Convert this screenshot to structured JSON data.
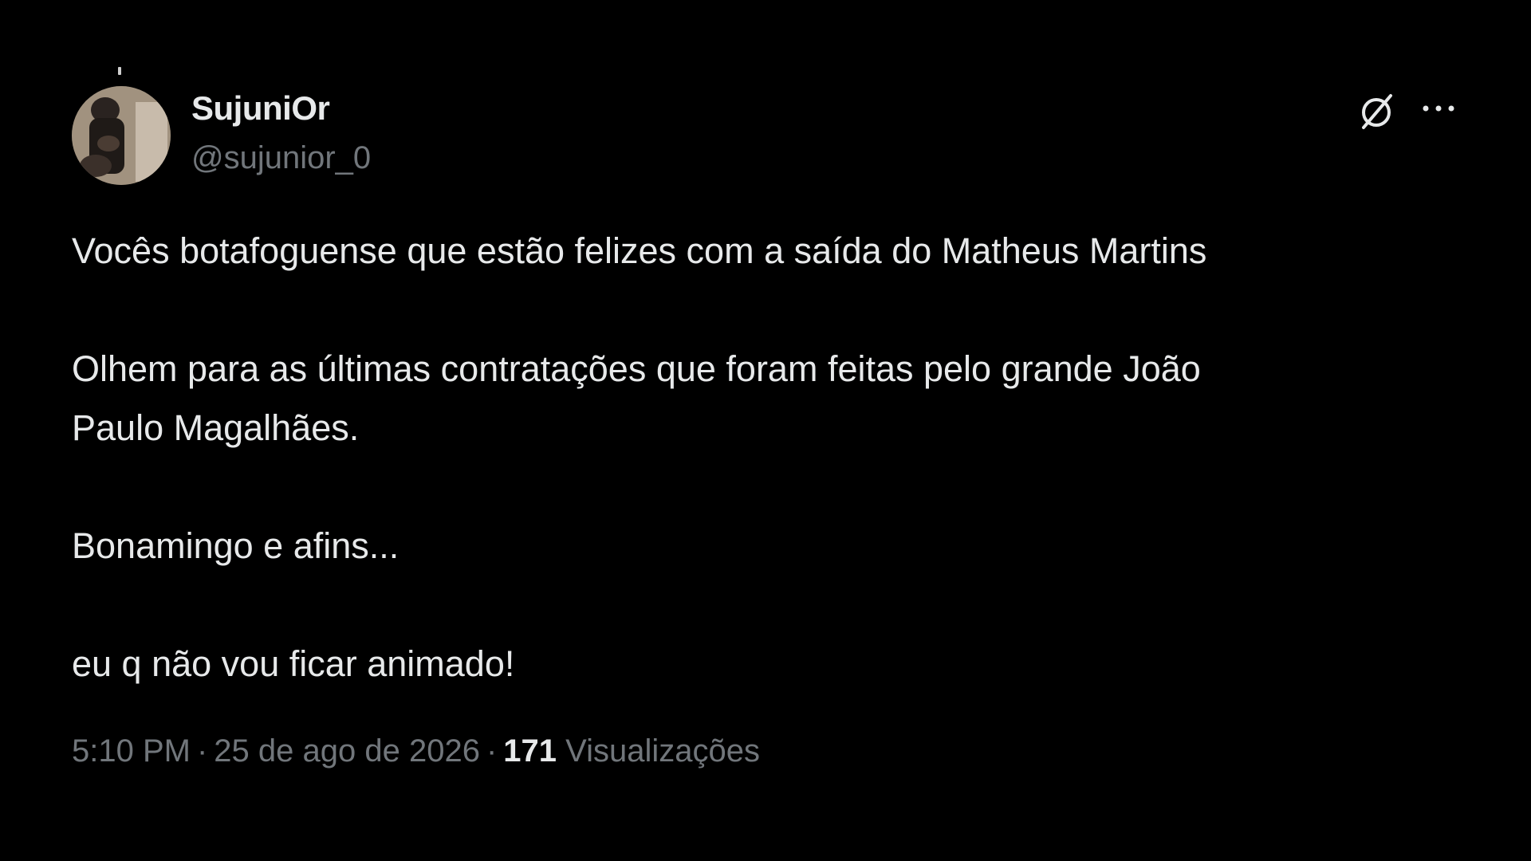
{
  "author": {
    "display_name": "SujuniOr",
    "handle": "@sujunior_0",
    "avatar_icon": "profile-photo-avatar"
  },
  "actions": {
    "grok_icon": "grok-slashed-circle-icon",
    "more_icon": "more-dots-icon"
  },
  "tweet": {
    "paragraphs": [
      "Vocês botafoguense que estão felizes com a saída do Matheus Martins",
      "Olhem para as últimas contratações que foram feitas pelo grande João",
      "Paulo Magalhães.",
      "Bonamingo e afins...",
      "eu q não vou ficar animado!"
    ]
  },
  "meta": {
    "time": "5:10 PM",
    "separator": "·",
    "date": "25 de ago de 2026",
    "views_count": "171",
    "views_label": "Visualizações"
  },
  "colors": {
    "background": "#000000",
    "primary_text": "#e7e9ea",
    "secondary_text": "#71767b"
  }
}
